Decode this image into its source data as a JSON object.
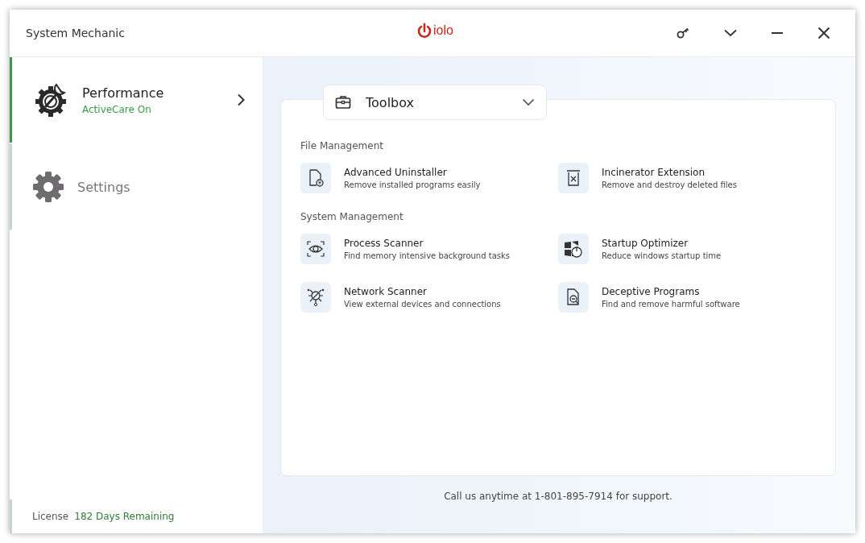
{
  "window": {
    "title": "System Mechanic",
    "logo": "iolo"
  },
  "sidebar": {
    "items": [
      {
        "kind": "performance",
        "label": "Performance",
        "status": "ActiveCare On",
        "selected": true
      },
      {
        "kind": "settings",
        "label": "Settings",
        "selected": false
      }
    ],
    "license": {
      "label": "License",
      "value": "182 Days Remaining"
    }
  },
  "toolbox": {
    "label": "Toolbox"
  },
  "sections": [
    {
      "title": "File Management",
      "tools": [
        {
          "kind": "uninstall",
          "name": "Advanced Uninstaller",
          "description": "Remove installed programs easily"
        },
        {
          "kind": "incinerator",
          "name": "Incinerator Extension",
          "description": "Remove and destroy deleted files"
        }
      ]
    },
    {
      "title": "System Management",
      "tools": [
        {
          "kind": "process",
          "name": "Process Scanner",
          "description": "Find memory intensive background tasks"
        },
        {
          "kind": "startup",
          "name": "Startup Optimizer",
          "description": "Reduce windows startup time"
        },
        {
          "kind": "network",
          "name": "Network Scanner",
          "description": "View external devices and connections"
        },
        {
          "kind": "deceptive",
          "name": "Deceptive Programs",
          "description": "Find and remove harmful software"
        }
      ]
    }
  ],
  "support": "Call us anytime at 1-801-895-7914 for support."
}
